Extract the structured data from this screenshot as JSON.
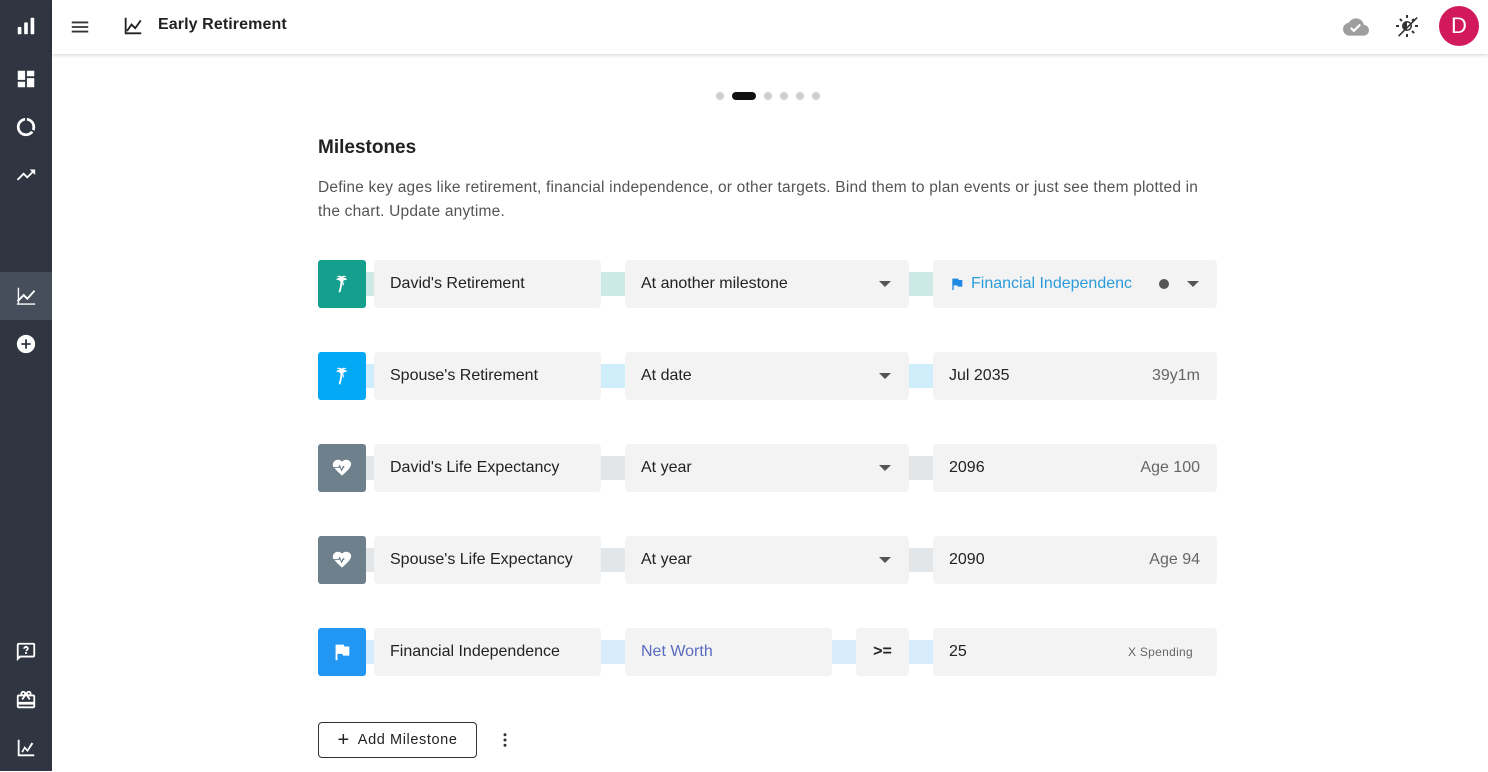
{
  "app": {
    "title": "Early Retirement",
    "avatar_initial": "D"
  },
  "pager": {
    "count": 6,
    "active_index": 1
  },
  "milestones": {
    "heading": "Milestones",
    "description": "Define key ages like retirement, financial independence, or other targets. Bind them to plan events or just see them plotted in the chart. Update anytime.",
    "rows": [
      {
        "name": "David's Retirement",
        "mode": "At another milestone",
        "value": "Financial Independenc",
        "sub": "",
        "icon": "palm-tree-icon",
        "color": "#15a08e",
        "link_color": "#cde9e6"
      },
      {
        "name": "Spouse's Retirement",
        "mode": "At date",
        "value": "Jul 2035",
        "sub": "39y1m",
        "icon": "palm-tree-icon",
        "color": "#03a9f4",
        "link_color": "#cfedfb"
      },
      {
        "name": "David's Life Expectancy",
        "mode": "At year",
        "value": "2096",
        "sub": "Age 100",
        "icon": "heart-pulse-icon",
        "color": "#6e808c",
        "link_color": "#e2e6e9"
      },
      {
        "name": "Spouse's Life Expectancy",
        "mode": "At year",
        "value": "2090",
        "sub": "Age 94",
        "icon": "heart-pulse-icon",
        "color": "#6e808c",
        "link_color": "#e2e6e9"
      },
      {
        "name": "Financial Independence",
        "metric": "Net Worth",
        "operator": ">=",
        "value": "25",
        "sub": "X Spending",
        "icon": "flag-icon",
        "color": "#2196f3",
        "link_color": "#d6ebfb"
      }
    ],
    "add_button_label": "Add Milestone"
  }
}
